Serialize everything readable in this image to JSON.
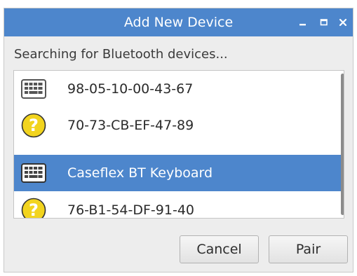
{
  "window": {
    "title": "Add New Device"
  },
  "status": {
    "text": "Searching for Bluetooth devices..."
  },
  "devices": [
    {
      "label": "98-05-10-00-43-67",
      "icon": "keyboard-icon",
      "selected": false
    },
    {
      "label": "70-73-CB-EF-47-89",
      "icon": "unknown-device-icon",
      "selected": false
    },
    {
      "label": "Caseflex BT Keyboard",
      "icon": "keyboard-icon",
      "selected": true
    },
    {
      "label": "76-B1-54-DF-91-40",
      "icon": "unknown-device-icon",
      "selected": false
    }
  ],
  "buttons": {
    "cancel_label": "Cancel",
    "pair_label": "Pair"
  },
  "colors": {
    "accent": "#4d86cc",
    "question_icon_fill": "#f2d41e",
    "window_bg": "#ededed"
  }
}
